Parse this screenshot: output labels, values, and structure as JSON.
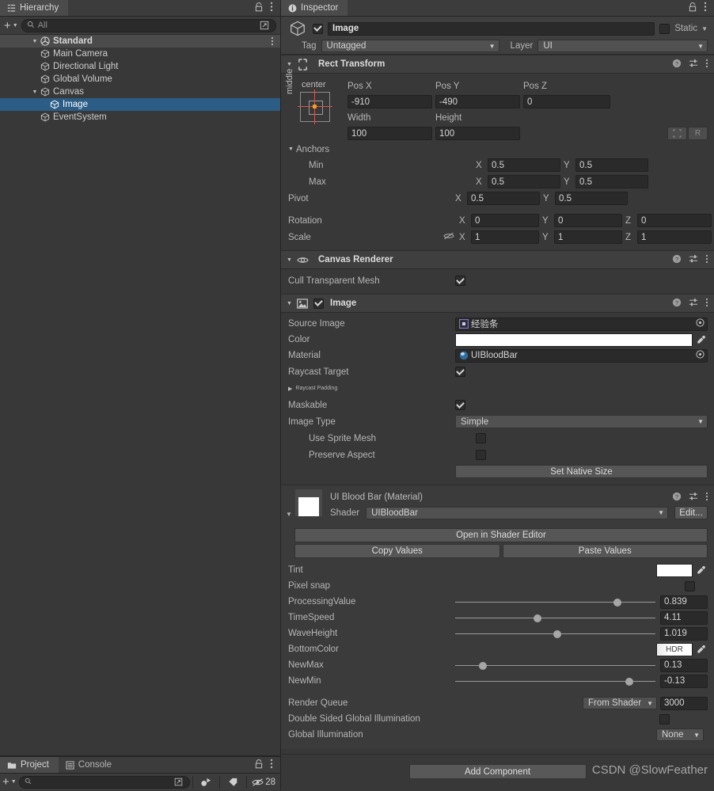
{
  "hierarchy": {
    "tab_label": "Hierarchy",
    "search_placeholder": "All",
    "add_label": "+",
    "items": [
      {
        "label": "Standard",
        "type": "scene",
        "depth": 0,
        "expanded": true
      },
      {
        "label": "Main Camera",
        "type": "gameobject",
        "depth": 2,
        "expanded": false
      },
      {
        "label": "Directional Light",
        "type": "gameobject",
        "depth": 2,
        "expanded": false
      },
      {
        "label": "Global Volume",
        "type": "gameobject",
        "depth": 2,
        "expanded": false
      },
      {
        "label": "Canvas",
        "type": "gameobject",
        "depth": 1,
        "expanded": true
      },
      {
        "label": "Image",
        "type": "gameobject",
        "depth": 2,
        "selected": true
      },
      {
        "label": "EventSystem",
        "type": "gameobject",
        "depth": 1,
        "expanded": false
      }
    ]
  },
  "project": {
    "tab_project": "Project",
    "tab_console": "Console",
    "search_placeholder": "",
    "hidden_count": "28"
  },
  "inspector": {
    "tab_label": "Inspector",
    "gameobject": {
      "name": "Image",
      "enabled": true,
      "static_label": "Static",
      "static_checked": false,
      "tag_label": "Tag",
      "tag_value": "Untagged",
      "layer_label": "Layer",
      "layer_value": "UI"
    },
    "rect_transform": {
      "title": "Rect Transform",
      "anchor_preset_top": "center",
      "anchor_preset_left": "middle",
      "pos_x_label": "Pos X",
      "pos_y_label": "Pos Y",
      "pos_z_label": "Pos Z",
      "pos_x": "-910",
      "pos_y": "-490",
      "pos_z": "0",
      "width_label": "Width",
      "height_label": "Height",
      "width": "100",
      "height": "100",
      "blueprint_label": "",
      "raw_label": "R",
      "anchors_label": "Anchors",
      "min_label": "Min",
      "max_label": "Max",
      "pivot_label": "Pivot",
      "anchor_min_x": "0.5",
      "anchor_min_y": "0.5",
      "anchor_max_x": "0.5",
      "anchor_max_y": "0.5",
      "pivot_x": "0.5",
      "pivot_y": "0.5",
      "rotation_label": "Rotation",
      "rotation_x": "0",
      "rotation_y": "0",
      "rotation_z": "0",
      "scale_label": "Scale",
      "scale_x": "1",
      "scale_y": "1",
      "scale_z": "1",
      "axis_x": "X",
      "axis_y": "Y",
      "axis_z": "Z"
    },
    "canvas_renderer": {
      "title": "Canvas Renderer",
      "cull_label": "Cull Transparent Mesh",
      "cull_checked": true
    },
    "image": {
      "title": "Image",
      "enabled": true,
      "source_image_label": "Source Image",
      "source_image_value": "经验条",
      "color_label": "Color",
      "color_value": "#FFFFFF",
      "material_label": "Material",
      "material_value": "UIBloodBar",
      "raycast_target_label": "Raycast Target",
      "raycast_target_checked": true,
      "raycast_padding_label": "Raycast Padding",
      "maskable_label": "Maskable",
      "maskable_checked": true,
      "image_type_label": "Image Type",
      "image_type_value": "Simple",
      "use_sprite_mesh_label": "Use Sprite Mesh",
      "use_sprite_mesh_checked": false,
      "preserve_aspect_label": "Preserve Aspect",
      "preserve_aspect_checked": false,
      "set_native_size_label": "Set Native Size"
    },
    "material": {
      "title": "UI Blood Bar (Material)",
      "shader_label": "Shader",
      "shader_value": "UIBloodBar",
      "edit_label": "Edit...",
      "open_shader_editor_label": "Open in Shader Editor",
      "copy_values_label": "Copy Values",
      "paste_values_label": "Paste Values",
      "properties": [
        {
          "name": "Tint",
          "kind": "color",
          "value": "#FFFFFF"
        },
        {
          "name": "Pixel snap",
          "kind": "toggle",
          "checked": false
        },
        {
          "name": "ProcessingValue",
          "kind": "slider",
          "value": "0.839",
          "pct": 81
        },
        {
          "name": "TimeSpeed",
          "kind": "slider",
          "value": "4.11",
          "pct": 41
        },
        {
          "name": "WaveHeight",
          "kind": "slider",
          "value": "1.019",
          "pct": 51
        },
        {
          "name": "BottomColor",
          "kind": "hdrcolor",
          "value": "HDR"
        },
        {
          "name": "NewMax",
          "kind": "slider",
          "value": "0.13",
          "pct": 14
        },
        {
          "name": "NewMin",
          "kind": "slider",
          "value": "-0.13",
          "pct": 87
        }
      ],
      "render_queue_label": "Render Queue",
      "render_queue_mode": "From Shader",
      "render_queue_value": "3000",
      "double_sided_gi_label": "Double Sided Global Illumination",
      "double_sided_gi_checked": false,
      "global_illumination_label": "Global Illumination",
      "global_illumination_value": "None"
    },
    "add_component_label": "Add Component"
  },
  "watermark": "CSDN @SlowFeather"
}
